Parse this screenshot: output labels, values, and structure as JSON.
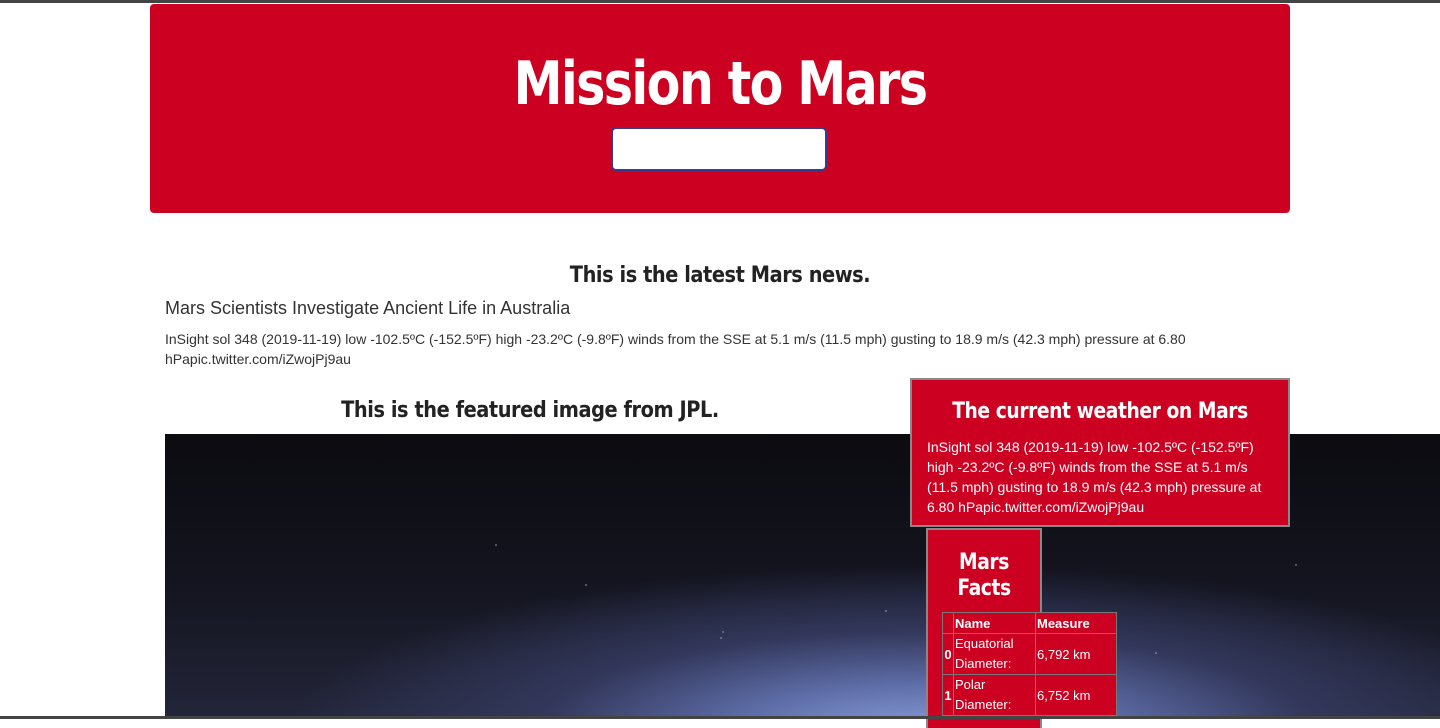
{
  "header": {
    "title": "Mission to Mars",
    "scrape_button_label": ""
  },
  "news": {
    "heading": "This is the latest Mars news.",
    "title": "Mars Scientists Investigate Ancient Life in Australia",
    "paragraph": "InSight sol 348 (2019-11-19) low -102.5ºC (-152.5ºF) high -23.2ºC (-9.8ºF) winds from the SSE at 5.1 m/s (11.5 mph) gusting to 18.9 m/s (42.3 mph) pressure at 6.80 hPapic.twitter.com/iZwojPj9au"
  },
  "featured_image": {
    "heading": "This is the featured image from JPL."
  },
  "weather": {
    "heading": "The current weather on Mars",
    "text": "InSight sol 348 (2019-11-19) low -102.5ºC (-152.5ºF) high -23.2ºC (-9.8ºF) winds from the SSE at 5.1 m/s (11.5 mph) gusting to 18.9 m/s (42.3 mph) pressure at 6.80 hPapic.twitter.com/iZwojPj9au"
  },
  "facts": {
    "heading": "Mars Facts",
    "columns": [
      "Name",
      "Measure"
    ],
    "rows": [
      {
        "index": "0",
        "name": "Equatorial Diameter:",
        "measure": "6,792 km"
      },
      {
        "index": "1",
        "name": "Polar Diameter:",
        "measure": "6,752 km"
      }
    ]
  },
  "colors": {
    "accent_red": "#cc0020",
    "background": "#ffffff"
  }
}
